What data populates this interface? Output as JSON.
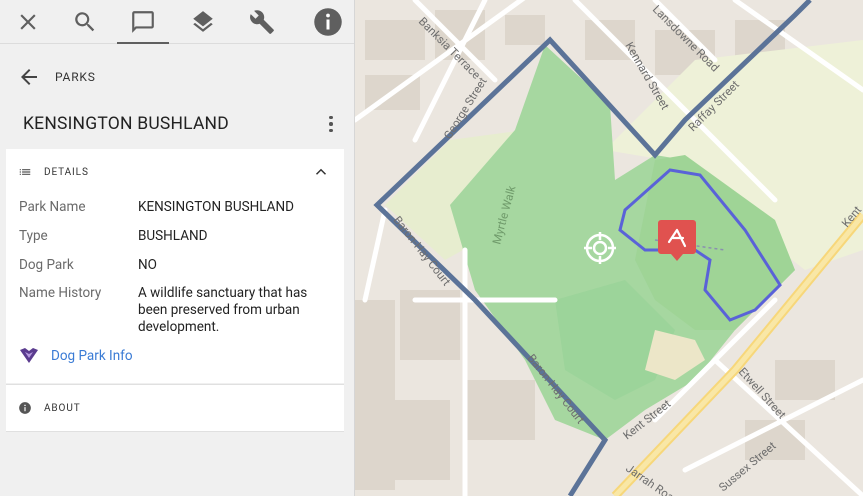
{
  "toolbar": {
    "buttons": [
      {
        "icon": "close-icon"
      },
      {
        "icon": "search-icon"
      },
      {
        "icon": "details-icon",
        "active": true
      },
      {
        "icon": "layers-icon"
      },
      {
        "icon": "wrench-icon"
      },
      {
        "icon": "info-icon"
      }
    ]
  },
  "breadcrumb": {
    "label": "PARKS"
  },
  "page": {
    "title": "KENSINGTON BUSHLAND"
  },
  "details": {
    "section_label": "DETAILS",
    "rows": [
      {
        "key": "Park Name",
        "value": "KENSINGTON BUSHLAND"
      },
      {
        "key": "Type",
        "value": "BUSHLAND"
      },
      {
        "key": "Dog Park",
        "value": "NO"
      },
      {
        "key": "Name History",
        "value": "A wildlife sanctuary that has been preserved from urban development."
      }
    ],
    "link_label": "Dog Park Info"
  },
  "about": {
    "section_label": "ABOUT"
  },
  "map": {
    "streets": [
      "Banksia Terrace",
      "George Street",
      "Lansdowne Road",
      "Kennard Street",
      "Raffay Street",
      "Myrtle Walk",
      "Baron-Hay Court",
      "Baron-Hay Court",
      "Kent Street",
      "Etwell Street",
      "Jarrah Road",
      "Sussex Street",
      "Kent"
    ],
    "colors": {
      "boundary": "#5b7398",
      "park": "#a6d7a0",
      "trail": "#5a62d8",
      "marker": "#e0524f"
    }
  }
}
